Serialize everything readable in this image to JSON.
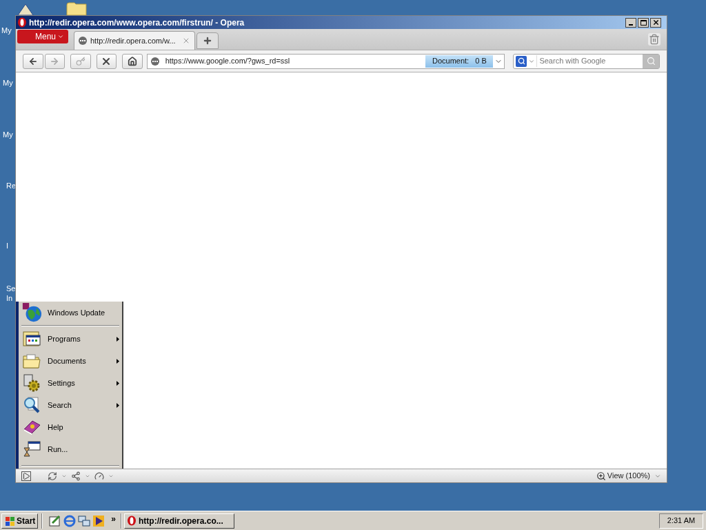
{
  "desktop": {
    "icon_labels": [
      "My",
      "My",
      "My",
      "Re",
      "I",
      "Se",
      "In"
    ]
  },
  "window": {
    "title": "http://redir.opera.com/www.opera.com/firstrun/ - Opera",
    "menu_button": "Menu",
    "tabs": [
      {
        "label": "http://redir.opera.com/w...",
        "selected": true
      }
    ],
    "address": "https://www.google.com/?gws_rd=ssl",
    "document_status": "Document:   0 B",
    "search": {
      "placeholder": "Search with Google"
    },
    "status_bar": {
      "zoom": "View (100%)"
    }
  },
  "start_menu": {
    "items": [
      {
        "kind": "update",
        "label": "Windows Update",
        "submenu": false
      },
      {
        "kind": "programs",
        "label": "Programs",
        "submenu": true
      },
      {
        "kind": "documents",
        "label": "Documents",
        "submenu": true
      },
      {
        "kind": "settings",
        "label": "Settings",
        "submenu": true
      },
      {
        "kind": "search",
        "label": "Search",
        "submenu": true
      },
      {
        "kind": "help",
        "label": "Help",
        "submenu": false
      },
      {
        "kind": "run",
        "label": "Run...",
        "submenu": false
      }
    ]
  },
  "taskbar": {
    "start": "Start",
    "overflow": "»",
    "tasks": [
      {
        "label": "http://redir.opera.co...",
        "selected": false
      }
    ],
    "clock": "2:31 AM"
  }
}
